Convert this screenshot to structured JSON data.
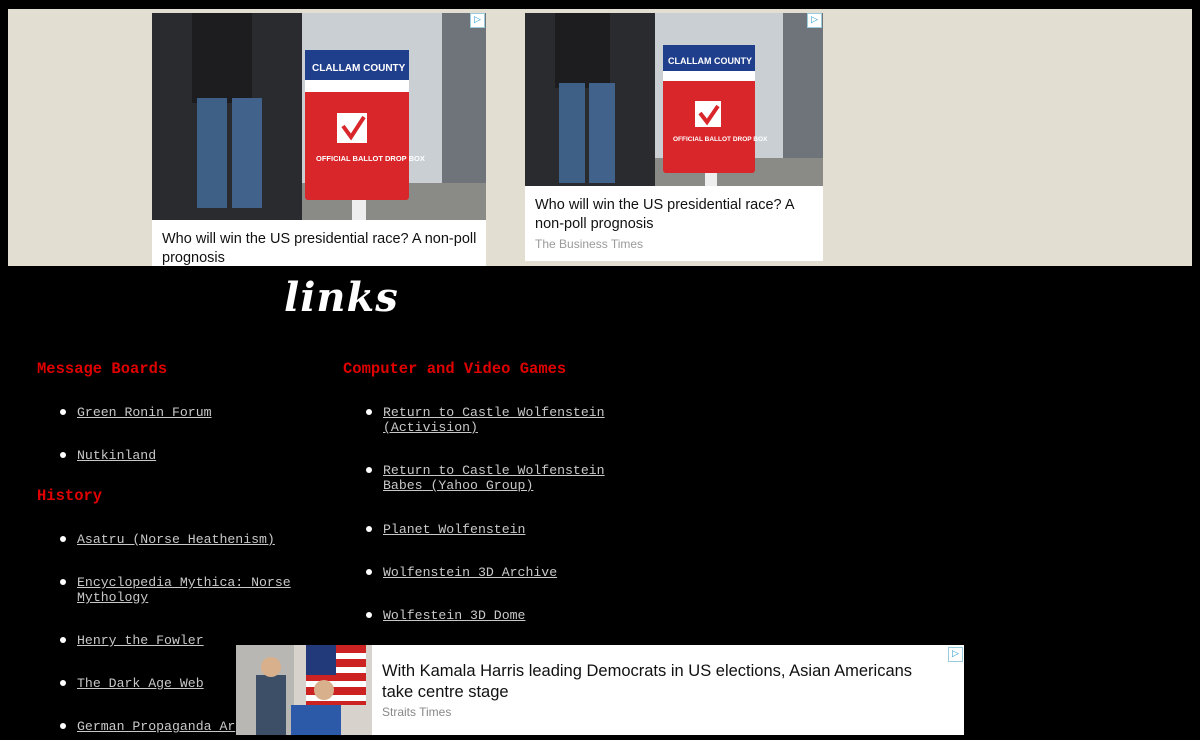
{
  "top_ads": [
    {
      "image_label": "ballot-drop-box-photo",
      "box_county_text": "CLALLAM COUNTY",
      "box_label_text": "OFFICIAL BALLOT DROP BOX",
      "caption": "Who will win the US presidential race? A non-poll prognosis",
      "source": ""
    },
    {
      "image_label": "ballot-drop-box-photo",
      "box_county_text": "CLALLAM COUNTY",
      "box_label_text": "OFFICIAL BALLOT DROP BOX",
      "caption": "Who will win the US presidential race? A non-poll prognosis",
      "source": "The Business Times"
    }
  ],
  "page": {
    "title": "links"
  },
  "sections": {
    "message_boards": {
      "heading": "Message Boards",
      "items": [
        "Green Ronin Forum",
        "Nutkinland"
      ]
    },
    "history": {
      "heading": "History",
      "items": [
        "Asatru (Norse Heathenism)",
        "Encyclopedia Mythica: Norse Mythology",
        "Henry the Fowler",
        "The Dark Age Web",
        "German Propaganda Ar"
      ]
    },
    "games": {
      "heading": "Computer and Video Games",
      "items": [
        "Return to Castle Wolfenstein (Activision)",
        "Return to Castle Wolfenstein Babes (Yahoo Group)",
        "Planet Wolfenstein",
        "Wolfenstein 3D Archive",
        "Wolfestein 3D Dome"
      ]
    }
  },
  "bottom_ad": {
    "caption": "With Kamala Harris leading Democrats in US elections, Asian Americans take centre stage",
    "source": "Straits Times"
  },
  "adchoices_icon": "adchoices-triangle-icon",
  "colors": {
    "page_bg": "#000000",
    "ad_strip_bg": "#e2ded2",
    "section_heading": "#e00000",
    "link_text": "#c8c8c8"
  }
}
